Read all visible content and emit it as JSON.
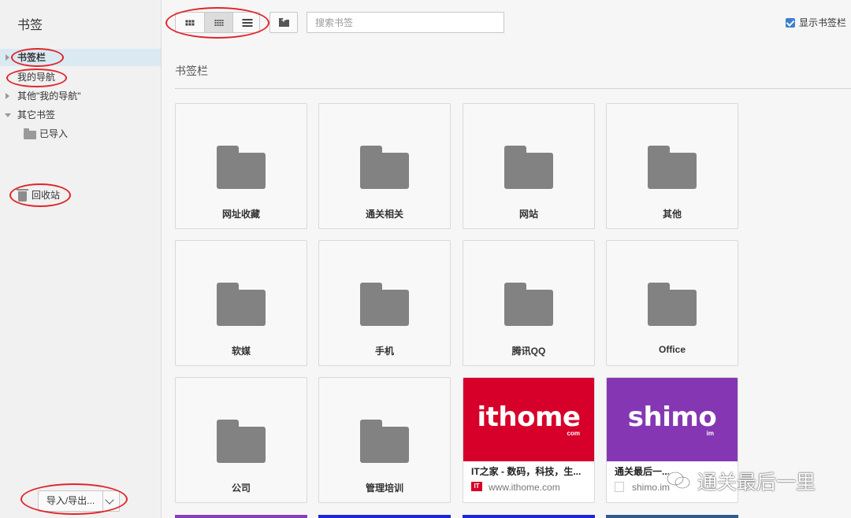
{
  "sidebar": {
    "title": "书签",
    "tree": [
      {
        "label": "书签栏"
      },
      {
        "label": "我的导航"
      },
      {
        "label": "其他\"我的导航\""
      },
      {
        "label": "其它书签"
      },
      {
        "label": "已导入"
      }
    ],
    "trash_label": "回收站",
    "import_export_label": "导入/导出..."
  },
  "toolbar": {
    "view_modes": [
      "large-grid",
      "small-grid",
      "list"
    ],
    "active_view": "small-grid",
    "search_placeholder": "搜索书签",
    "show_bookmarks_bar_label": "显示书签栏",
    "show_bookmarks_bar_checked": true
  },
  "main": {
    "section_title": "书签栏",
    "folders": [
      {
        "label": "网址收藏"
      },
      {
        "label": "通关相关"
      },
      {
        "label": "网站"
      },
      {
        "label": "其他"
      },
      {
        "label": "软媒"
      },
      {
        "label": "手机"
      },
      {
        "label": "腾讯QQ"
      },
      {
        "label": "Office"
      },
      {
        "label": "公司"
      },
      {
        "label": "管理培训"
      }
    ],
    "sites": [
      {
        "banner_text": "ithome",
        "banner_sub": "com",
        "banner_color": "#d7002a",
        "title": "IT之家 - 数码，科技，生...",
        "url": "www.ithome.com",
        "favicon": "IT"
      },
      {
        "banner_text": "shimo",
        "banner_sub": "im",
        "banner_color": "#8537b3",
        "title": "通关最后一...",
        "url": "shimo.im"
      }
    ]
  },
  "watermark": {
    "text": "通关最后一里"
  },
  "colors": {
    "annotation": "#e0262a",
    "selected_bg": "#dbe9f3",
    "checkbox": "#3c7fd0"
  }
}
